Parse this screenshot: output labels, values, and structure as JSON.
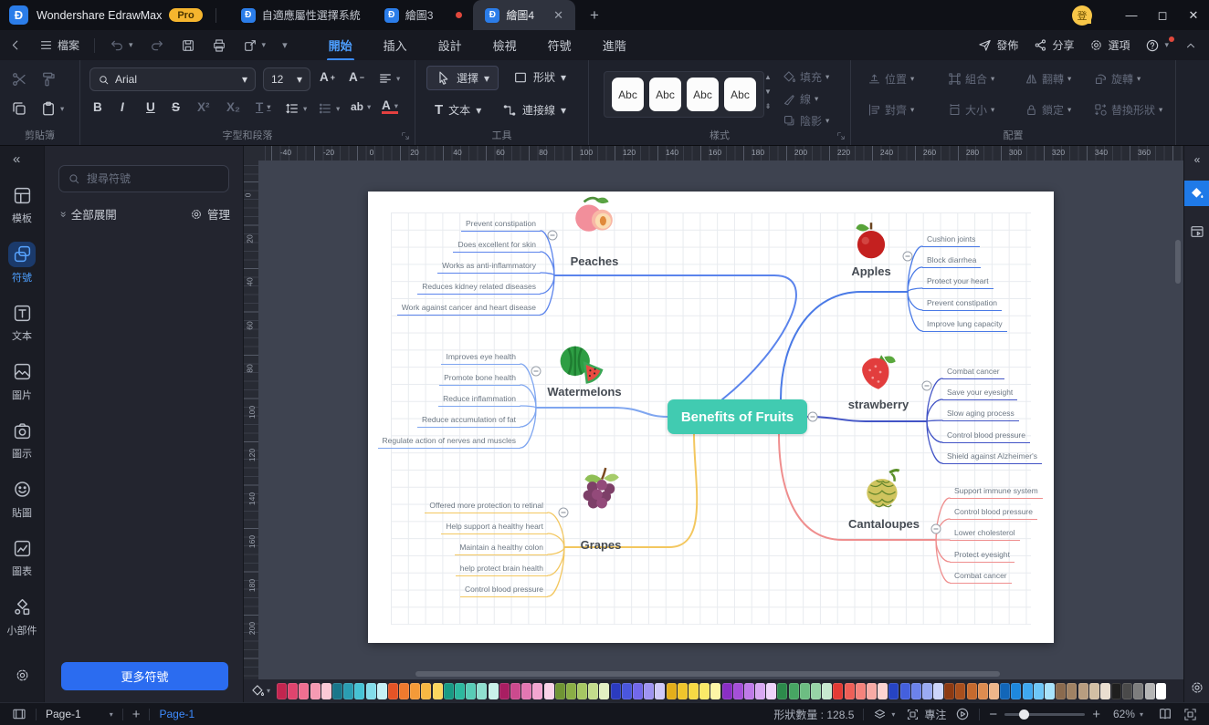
{
  "titlebar": {
    "app": "Wondershare EdrawMax",
    "pro": "Pro",
    "tabs": [
      "自適應屬性選擇系統",
      "繪圖3",
      "繪圖4"
    ],
    "avatar": "登"
  },
  "menubar": {
    "file": "檔案",
    "tabs": [
      "開始",
      "插入",
      "設計",
      "檢視",
      "符號",
      "進階"
    ],
    "publish": "發佈",
    "share": "分享",
    "options": "選項"
  },
  "ribbon": {
    "groups": {
      "clipboard": "剪貼簿",
      "font": "字型和段落",
      "tools": "工具",
      "style": "樣式",
      "arrange": "配置"
    },
    "font_name": "Arial",
    "font_size": "12",
    "fmt": {
      "bold": "B",
      "italic": "I",
      "underline": "U",
      "strike": "S",
      "sup": "X²",
      "sub": "X₂",
      "texttool": "T",
      "larger": "A",
      "smaller": "A",
      "highlight": "ab",
      "color": "A"
    },
    "tools": {
      "select": "選擇",
      "shape": "形狀",
      "text": "文本",
      "connector": "連接線"
    },
    "style_preview": "Abc",
    "style_btns": {
      "fill": "填充",
      "line": "線",
      "shadow": "陰影"
    },
    "arrange": {
      "position": "位置",
      "group": "組合",
      "flip": "翻轉",
      "rotate": "旋轉",
      "align": "對齊",
      "size": "大小",
      "lock": "鎖定",
      "replace": "替換形狀"
    }
  },
  "sidebar": {
    "items": [
      {
        "label": "模板",
        "icon": "templates",
        "active": false
      },
      {
        "label": "符號",
        "icon": "symbols",
        "active": true
      },
      {
        "label": "文本",
        "icon": "text",
        "active": false
      },
      {
        "label": "圖片",
        "icon": "images",
        "active": false
      },
      {
        "label": "圖示",
        "icon": "icons",
        "active": false
      },
      {
        "label": "貼圖",
        "icon": "stickers",
        "active": false
      },
      {
        "label": "圖表",
        "icon": "charts",
        "active": false
      },
      {
        "label": "小部件",
        "icon": "widgets",
        "active": false
      }
    ]
  },
  "symbols": {
    "search_placeholder": "搜尋符號",
    "expand_all": "全部展開",
    "manage": "管理",
    "more": "更多符號"
  },
  "canvas": {
    "h_ruler": [
      "-40",
      "-20",
      "0",
      "20",
      "40",
      "60",
      "80",
      "100",
      "120",
      "140",
      "160",
      "180",
      "200",
      "220",
      "240",
      "260",
      "280",
      "300",
      "320",
      "340",
      "360"
    ],
    "v_ruler": [
      "0",
      "20",
      "40",
      "60",
      "80",
      "100",
      "120",
      "140",
      "160",
      "180",
      "200"
    ]
  },
  "mindmap": {
    "center": "Benefits of Fruits",
    "center_color": "#41cbb1",
    "branches": [
      {
        "name": "Peaches",
        "icon": "peach",
        "color": "#5b84ec",
        "items": [
          "Prevent constipation",
          "Does excellent for skin",
          "Works as anti-inflammatory",
          "Reduces kidney related diseases",
          "Work against cancer and heart disease"
        ]
      },
      {
        "name": "Apples",
        "icon": "apple",
        "color": "#4a7ae6",
        "items": [
          "Cushion joints",
          "Block diarrhea",
          "Protect your heart",
          "Prevent constipation",
          "Improve lung capacity"
        ]
      },
      {
        "name": "Watermelons",
        "icon": "watermelon",
        "color": "#7fa6f0",
        "items": [
          "Improves eye health",
          "Promote bone health",
          "Reduce inflammation",
          "Reduce accumulation of fat",
          "Regulate action of nerves and muscles"
        ]
      },
      {
        "name": "strawberry",
        "icon": "strawberry",
        "color": "#4254c6",
        "items": [
          "Combat cancer",
          "Save your eyesight",
          "Slow aging process",
          "Control blood pressure",
          "Shield against Alzheimer's"
        ]
      },
      {
        "name": "Grapes",
        "icon": "grapes",
        "color": "#f3c75f",
        "items": [
          "Offered more protection to retinal",
          "Help support a healthy heart",
          "Maintain a healthy colon",
          "help protect brain health",
          "Control blood pressure"
        ]
      },
      {
        "name": "Cantaloupes",
        "icon": "cantaloupe",
        "color": "#ef8e8e",
        "items": [
          "Support immune system",
          "Control blood pressure",
          "Lower cholesterol",
          "Protect eyesight",
          "Combat cancer"
        ]
      }
    ]
  },
  "palette": {
    "colors": [
      "#c2254f",
      "#e0446e",
      "#ef6f91",
      "#f59ab2",
      "#fbc9d6",
      "#19768a",
      "#2a9db2",
      "#46c2d4",
      "#83dcea",
      "#c6f1f7",
      "#e45426",
      "#f07a2e",
      "#f49a38",
      "#f8b843",
      "#fbd55e",
      "#189a84",
      "#2cb89e",
      "#58ccb6",
      "#8fdfcf",
      "#c9f2ea",
      "#a81e62",
      "#cc4a8e",
      "#e377b2",
      "#f2a6d0",
      "#fad3e8",
      "#6f9434",
      "#8aae46",
      "#a6c763",
      "#c3dc8c",
      "#e2efc2",
      "#2b3bbf",
      "#4a56dd",
      "#7268ea",
      "#9f94f2",
      "#cfc9f9",
      "#e3ae1a",
      "#f0c52c",
      "#f7d944",
      "#fae968",
      "#fdf5a6",
      "#8a2ec4",
      "#a54fd8",
      "#bf7ae8",
      "#d8a8f2",
      "#eed4fa",
      "#2c8a4b",
      "#47a563",
      "#6dbd82",
      "#97d3a6",
      "#c7e9cf",
      "#e33a34",
      "#ee5f57",
      "#f4837c",
      "#f8aba5",
      "#fcd4d1",
      "#2644c4",
      "#4460dd",
      "#6c82ea",
      "#9aabf3",
      "#ccd5fa",
      "#8c3a12",
      "#a84f1d",
      "#c56a2e",
      "#dd8c50",
      "#efb68a",
      "#1266b8",
      "#1e88dd",
      "#3fa8f0",
      "#6ec7f8",
      "#a8e3fc",
      "#8a6a4e",
      "#a08264",
      "#b89d80",
      "#d2bfa4",
      "#eaded0",
      "#1f1f1f",
      "#4a4a4a",
      "#7d7d7d",
      "#b5b5b5",
      "#ffffff"
    ]
  },
  "statusbar": {
    "page_menu": "Page-1",
    "page_tab": "Page-1",
    "shape_count": "形狀數量 : 128.5",
    "focus": "專注",
    "zoom": "62%"
  }
}
